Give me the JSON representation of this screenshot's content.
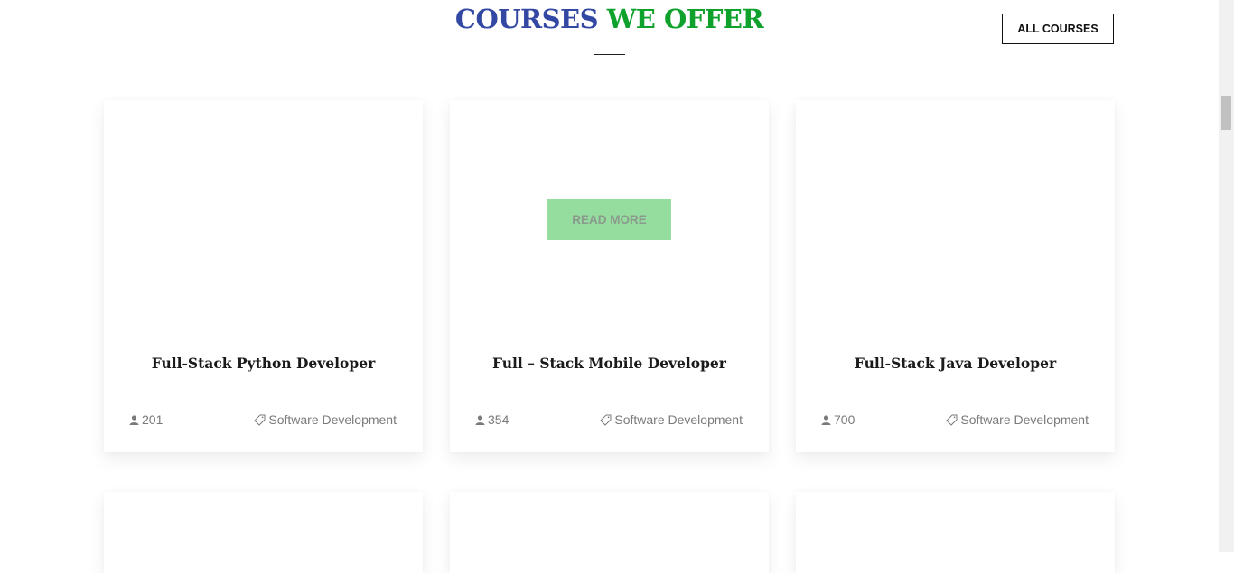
{
  "section": {
    "title_part1": "COURSES",
    "title_part2": "WE OFFER",
    "all_courses_label": "ALL COURSES"
  },
  "courses": [
    {
      "title": "Full-Stack Python Developer",
      "students": "201",
      "category": "Software Development"
    },
    {
      "title": "Full – Stack Mobile Developer",
      "students": "354",
      "category": "Software Development",
      "hover_label": "READ MORE"
    },
    {
      "title": "Full-Stack Java Developer",
      "students": "700",
      "category": "Software Development"
    }
  ],
  "icons": {
    "students": "user-icon",
    "category": "tag-icon"
  },
  "colors": {
    "title_blue": "#3348a3",
    "title_green": "#0ea12b",
    "read_more_bg": "#95dc9f"
  }
}
